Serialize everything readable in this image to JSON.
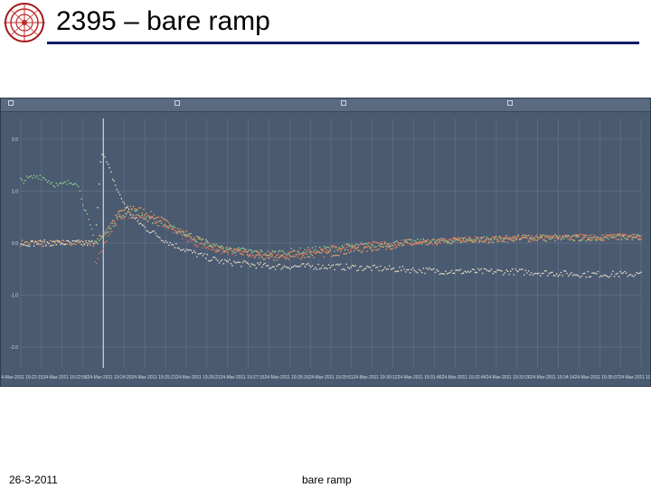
{
  "slide": {
    "title": "2395 – bare ramp",
    "footer_date": "26-3-2011",
    "footer_center": "bare ramp"
  },
  "colors": {
    "title_rule": "#0d1a66",
    "plot_bg": "#4a5a70",
    "grid": "#7d8da3"
  },
  "chart_data": {
    "type": "scatter",
    "legend_placement": "top",
    "grid": true,
    "legend": [
      "",
      "",
      "",
      ""
    ],
    "xtick_labels": [
      "24-Mar-2011 19:22:15",
      "24-Mar-2011 19:22:58",
      "24-Mar-2011 19:24:20",
      "24-Mar-2011 19:25:21",
      "24-Mar-2011 19:26:21",
      "24-Mar-2011 19:27:15",
      "24-Mar-2011 19:28:15",
      "24-Mar-2011 19:29:51",
      "24-Mar-2011 19:30:12",
      "24-Mar-2011 19:31:46",
      "24-Mar-2011 19:32:44",
      "24-Mar-2011 19:33:26",
      "24-Mar-2011 19:34:14",
      "24-Mar-2011 19:35:07",
      "24-Mar-2011 19:36:10"
    ],
    "ytick_labels": [
      "2.0",
      "1.0",
      "0.0",
      "-1.0",
      "-2.0"
    ],
    "xlabel": "",
    "ylabel": "",
    "series": [
      {
        "color": "#f0a060",
        "x": [
          0,
          4,
          8,
          12,
          14,
          16,
          18,
          20,
          22,
          24,
          28,
          32,
          36,
          40,
          50,
          60,
          70,
          80,
          90,
          100
        ],
        "y": [
          0.0,
          0.0,
          0.0,
          0.0,
          0.3,
          0.6,
          0.7,
          0.6,
          0.5,
          0.35,
          0.1,
          -0.1,
          -0.2,
          -0.3,
          -0.2,
          -0.05,
          0.05,
          0.08,
          0.1,
          0.12
        ]
      },
      {
        "color": "#e9dfc8",
        "x": [
          0,
          4,
          8,
          12,
          13,
          14,
          15,
          16,
          18,
          20,
          22,
          24,
          28,
          32,
          36,
          40,
          50,
          60,
          70,
          80,
          90,
          100
        ],
        "y": [
          0.0,
          0.0,
          0.0,
          0.0,
          1.8,
          1.5,
          1.2,
          0.9,
          0.5,
          0.3,
          0.15,
          0.0,
          -0.2,
          -0.35,
          -0.4,
          -0.45,
          -0.45,
          -0.5,
          -0.55,
          -0.55,
          -0.6,
          -0.6
        ]
      },
      {
        "color": "#8fd08a",
        "x": [
          0,
          3,
          6,
          9,
          12,
          14,
          16,
          18,
          20,
          24,
          28,
          32,
          40,
          50,
          60,
          70,
          80,
          90,
          100
        ],
        "y": [
          1.2,
          1.3,
          1.1,
          1.2,
          0.0,
          0.2,
          0.55,
          0.6,
          0.5,
          0.3,
          0.1,
          -0.1,
          -0.2,
          -0.1,
          0.0,
          0.05,
          0.1,
          0.1,
          0.12
        ]
      },
      {
        "color": "#e07060",
        "x": [
          12,
          14,
          16,
          18,
          20,
          24,
          28,
          32,
          40,
          50,
          60,
          70,
          80,
          90,
          100
        ],
        "y": [
          -0.4,
          0.1,
          0.5,
          0.55,
          0.5,
          0.3,
          0.0,
          -0.15,
          -0.25,
          -0.1,
          0.0,
          0.05,
          0.1,
          0.12,
          0.12
        ]
      }
    ]
  }
}
